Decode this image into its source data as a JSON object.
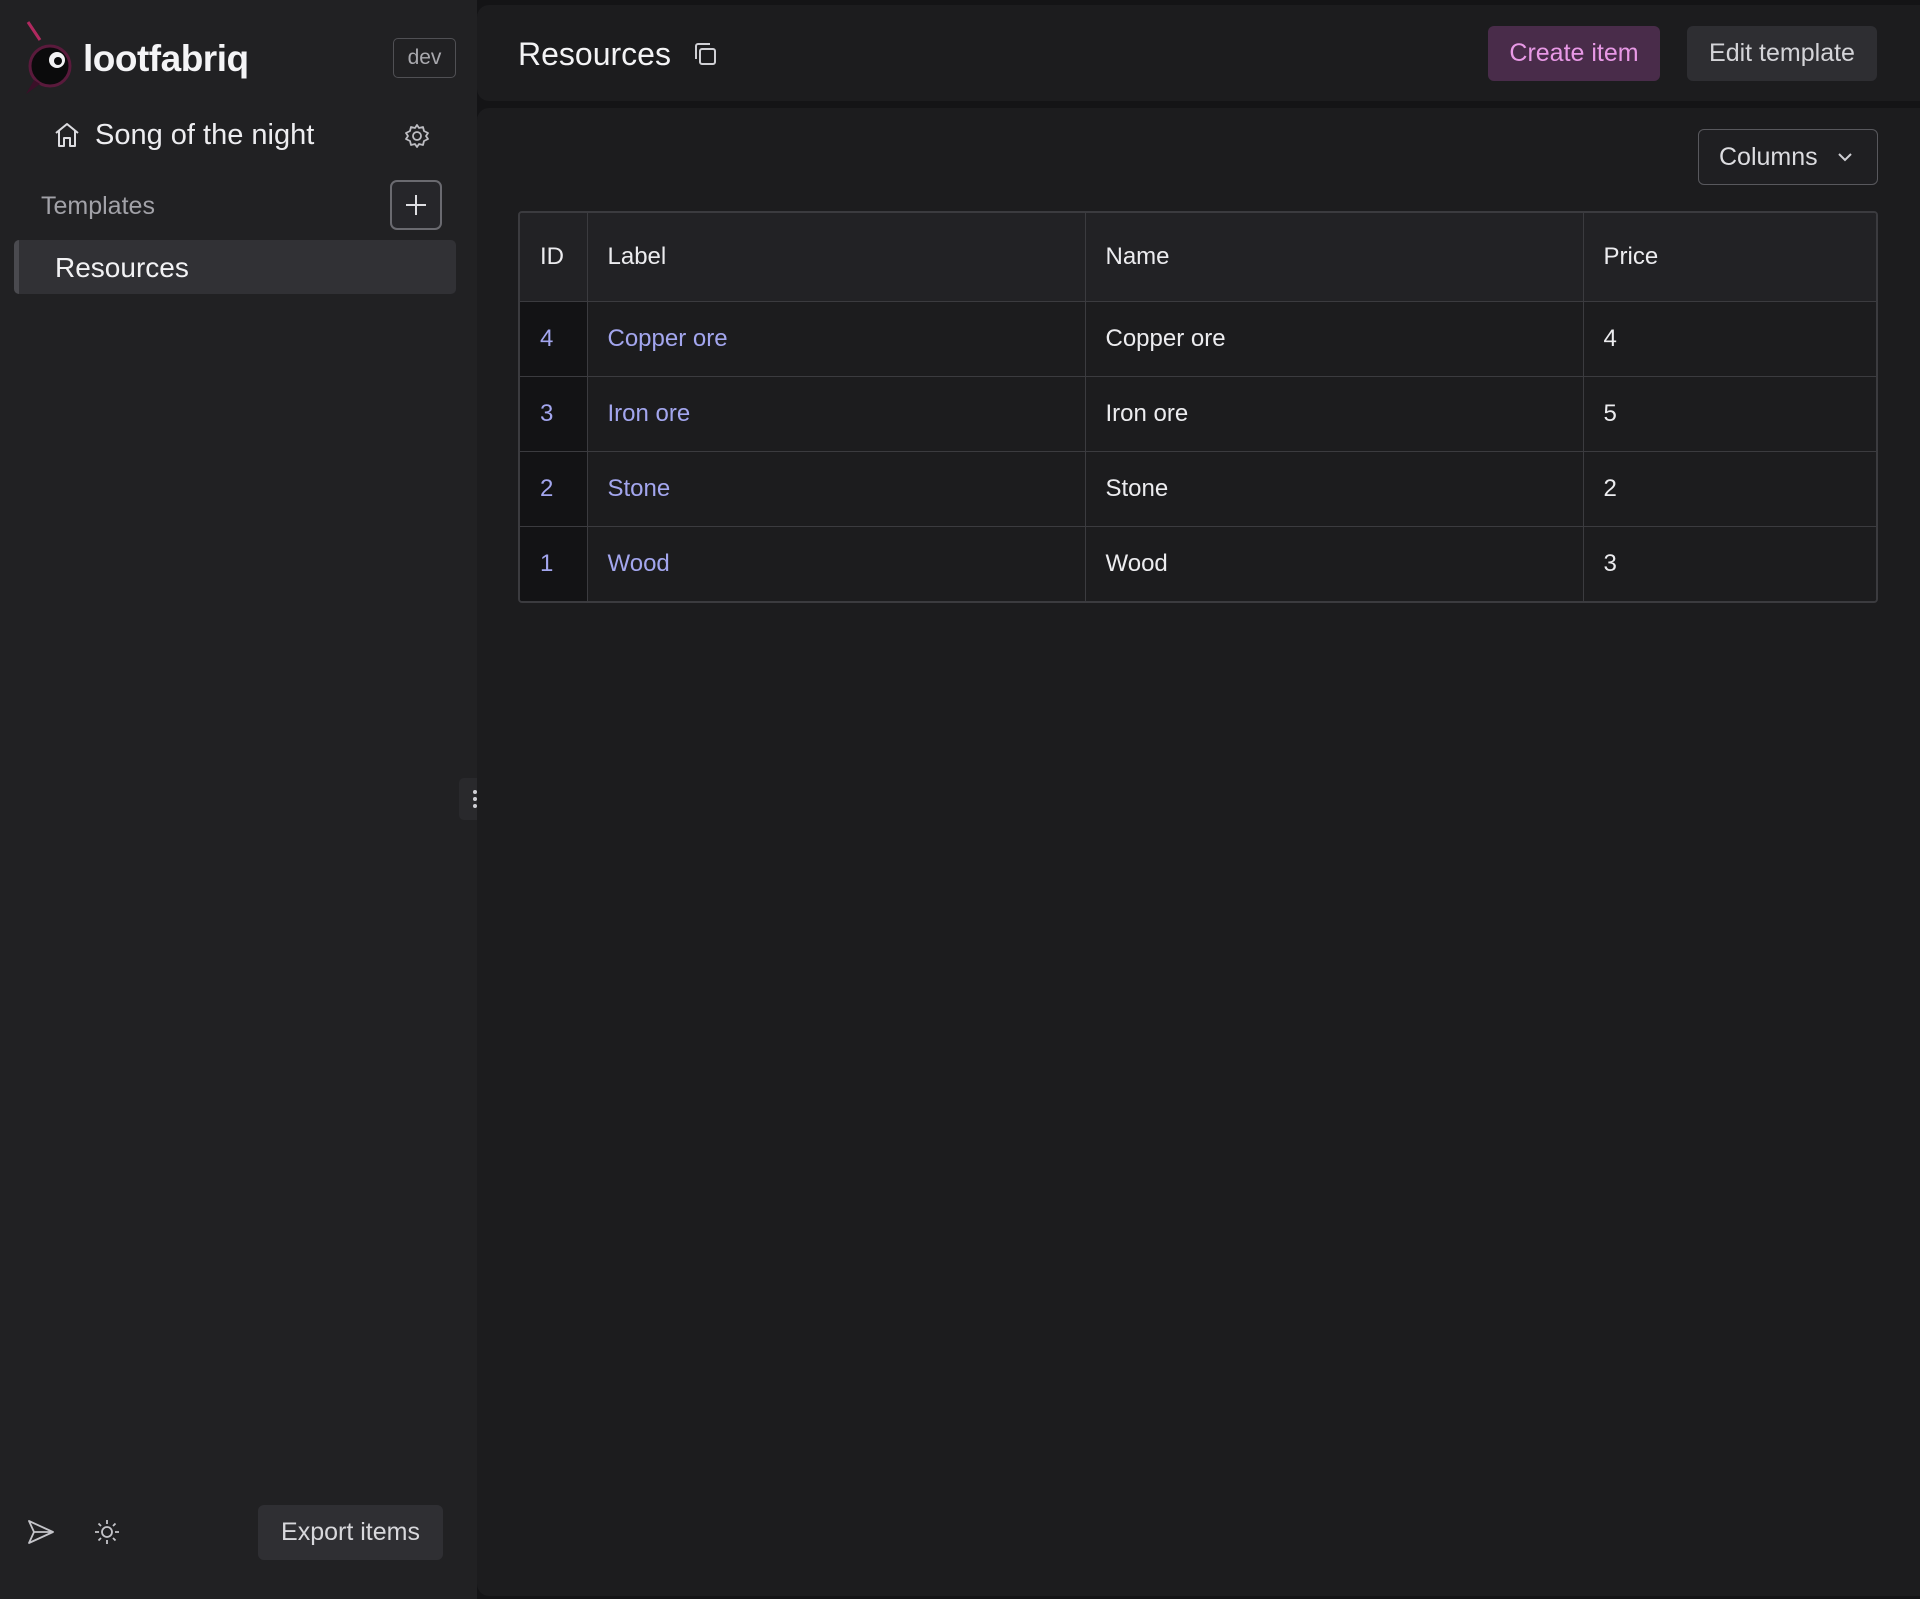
{
  "app": {
    "brand": "lootfabriq",
    "env_badge": "dev"
  },
  "sidebar": {
    "project_name": "Song of the night",
    "templates_label": "Templates",
    "items": [
      {
        "label": "Resources",
        "active": true
      }
    ],
    "export_label": "Export items"
  },
  "header": {
    "title": "Resources",
    "create_label": "Create item",
    "edit_label": "Edit template"
  },
  "toolbar": {
    "columns_label": "Columns"
  },
  "table": {
    "columns": [
      "ID",
      "Label",
      "Name",
      "Price"
    ],
    "rows": [
      {
        "id": "4",
        "label": "Copper ore",
        "name": "Copper ore",
        "price": "4"
      },
      {
        "id": "3",
        "label": "Iron ore",
        "name": "Iron ore",
        "price": "5"
      },
      {
        "id": "2",
        "label": "Stone",
        "name": "Stone",
        "price": "2"
      },
      {
        "id": "1",
        "label": "Wood",
        "name": "Wood",
        "price": "3"
      }
    ]
  },
  "colors": {
    "accent": "#492c4a",
    "accent_text": "#e899e6",
    "link": "#a3a6ee",
    "background": "#1c1c1e",
    "sidebar": "#212123"
  },
  "icons": [
    "logo-icon",
    "home-icon",
    "gear-icon",
    "plus-icon",
    "copy-icon",
    "chevron-down-icon",
    "send-icon",
    "sun-icon",
    "drag-handle-icon"
  ]
}
